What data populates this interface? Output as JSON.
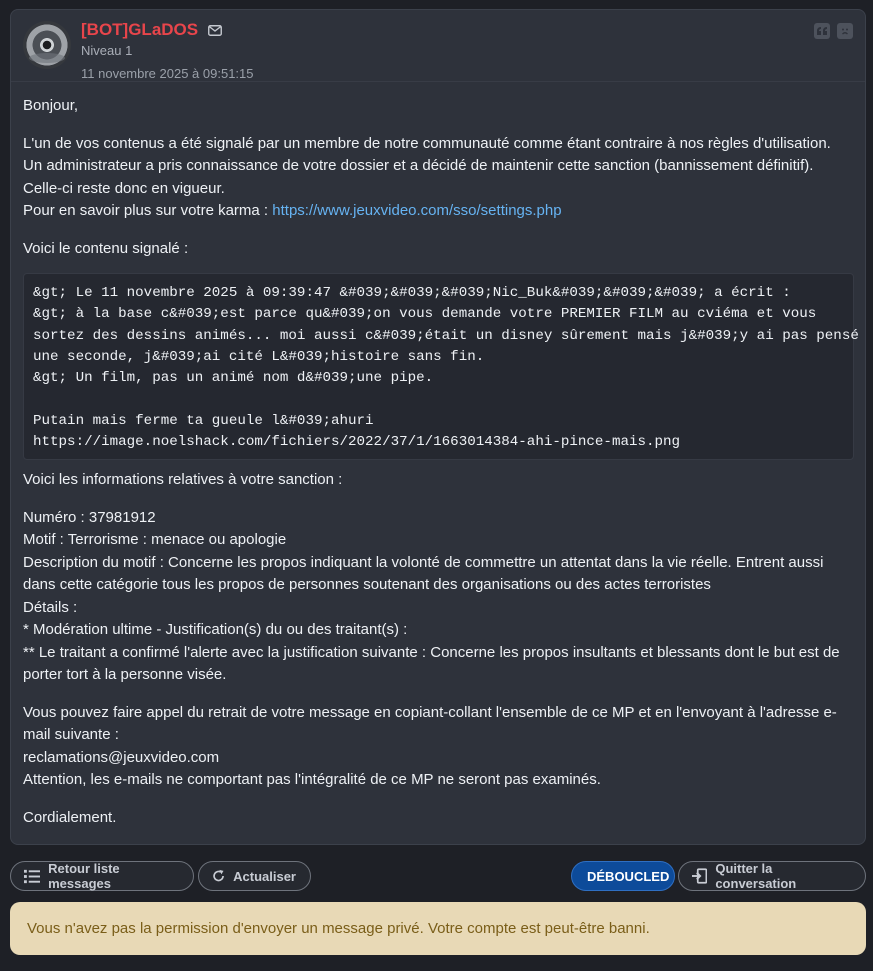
{
  "message": {
    "author": "[BOT]GLaDOS",
    "level": "Niveau 1",
    "date": "11 novembre 2025 à 09:51:15",
    "greeting": "Bonjour,",
    "intro_lines": [
      "L'un de vos contenus a été signalé par un membre de notre communauté comme étant contraire à nos règles d'utilisation.",
      "Un administrateur a pris connaissance de votre dossier et a décidé de maintenir cette sanction (bannissement définitif).",
      "Celle-ci reste donc en vigueur."
    ],
    "karma_prefix": "Pour en savoir plus sur votre karma : ",
    "karma_link": "https://www.jeuxvideo.com/sso/settings.php",
    "reported_heading": "Voici le contenu signalé :",
    "quote_lines": [
      "&gt; Le 11 novembre 2025 à 09:39:47 &#039;&#039;&#039;Nic_Buk&#039;&#039;&#039; a écrit :",
      "&gt; à la base c&#039;est parce qu&#039;on vous demande votre PREMIER FILM au cviéma et vous",
      "sortez des dessins animés... moi aussi c&#039;était un disney sûrement mais j&#039;y ai pas pensé",
      "une seconde, j&#039;ai cité L&#039;histoire sans fin.",
      "&gt; Un film, pas un animé nom d&#039;une pipe.",
      "",
      "Putain mais ferme ta gueule l&#039;ahuri",
      "https://image.noelshack.com/fichiers/2022/37/1/1663014384-ahi-pince-mais.png"
    ],
    "sanction_heading": "Voici les informations relatives à votre sanction :",
    "sanction_lines": [
      "Numéro : 37981912",
      "Motif : Terrorisme : menace ou apologie",
      "Description du motif : Concerne les propos indiquant la volonté de commettre un attentat dans la vie réelle. Entrent aussi",
      "dans cette catégorie tous les propos de personnes soutenant des organisations ou des actes terroristes",
      "Détails :",
      "* Modération ultime - Justification(s) du ou des traitant(s) :",
      "** Le traitant a confirmé l'alerte avec la justification suivante : Concerne les propos insultants et blessants dont le but est de",
      "porter tort à la personne visée."
    ],
    "appeal_lines": [
      "Vous pouvez faire appel du retrait de votre message en copiant-collant l'ensemble de ce MP et en l'envoyant à l'adresse e-",
      "mail suivante :",
      "reclamations@jeuxvideo.com",
      "Attention, les e-mails ne comportant pas l'intégralité de ce MP ne seront pas examinés."
    ],
    "closing": "Cordialement."
  },
  "toolbar": {
    "back_label": "Retour liste messages",
    "refresh_label": "Actualiser",
    "unblock_label": "DÉBOUCLED",
    "leave_label": "Quitter la conversation"
  },
  "alert": {
    "text": "Vous n'avez pas la permission d'envoyer un message privé. Votre compte est peut-être banni."
  },
  "icons": [
    "mail-icon",
    "quote-icon",
    "sad-face-icon",
    "list-icon",
    "refresh-icon",
    "exit-icon"
  ],
  "colors": {
    "author": "#e8454b",
    "link": "#66b3f2",
    "primary_button": "#0d4b9a",
    "alert_bg": "#e8d9b6",
    "alert_text": "#7a5e19"
  }
}
